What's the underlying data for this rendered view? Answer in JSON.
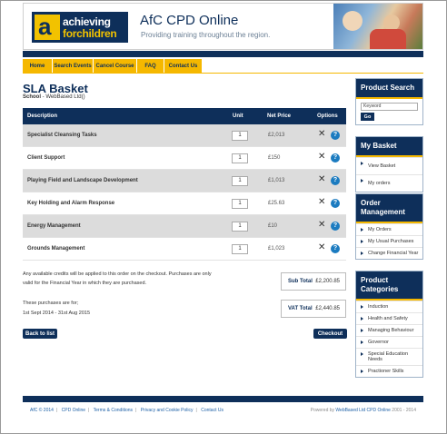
{
  "header": {
    "logo_line1": "achieving",
    "logo_line2": "forchildren",
    "site_title": "AfC CPD Online",
    "tagline": "Providing training throughout the region."
  },
  "nav": [
    "Home",
    "Search Events",
    "Cancel Course",
    "FAQ",
    "Contact Us"
  ],
  "page": {
    "title": "SLA Basket",
    "school_label": "School",
    "school_value": " - WebBased Ltd()"
  },
  "table": {
    "headers": {
      "description": "Description",
      "unit": "Unit",
      "net_price": "Net Price",
      "options": "Options"
    },
    "rows": [
      {
        "description": "Specialist Cleansing Tasks",
        "unit": "1",
        "price": "£2,013"
      },
      {
        "description": "Client Support",
        "unit": "1",
        "price": "£150"
      },
      {
        "description": "Playing Field and Landscape Development",
        "unit": "1",
        "price": "£1,013"
      },
      {
        "description": "Key Holding and Alarm Response",
        "unit": "1",
        "price": "£25.63"
      },
      {
        "description": "Energy Management",
        "unit": "1",
        "price": "£10"
      },
      {
        "description": "Grounds Management",
        "unit": "1",
        "price": "£1,023"
      }
    ],
    "delete_glyph": "✕",
    "info_glyph": "?"
  },
  "notes": {
    "credits_line1": "Any available credits will be applied to this order on the checkout. Purchases are only",
    "credits_line2": "valid for the Financial Year in which they are purchased.",
    "purchases_for": "These purchases are for;",
    "date_range": "1st Sept 2014 - 31st Aug 2015"
  },
  "totals": {
    "sub_total_label": "Sub Total",
    "sub_total_value": "£2,200.85",
    "vat_total_label": "VAT Total",
    "vat_total_value": "£2,440.85"
  },
  "buttons": {
    "back": "Back to list",
    "checkout": "Checkout"
  },
  "sidebar": {
    "product_search": {
      "title": "Product Search",
      "placeholder": "Keyword",
      "go": "Go"
    },
    "my_basket": {
      "title": "My Basket",
      "items": [
        "View Basket",
        "My orders"
      ]
    },
    "order_management": {
      "title": "Order Management",
      "items": [
        "My Orders",
        "My Usual Purchases",
        "Change Financial Year"
      ]
    },
    "product_categories": {
      "title": "Product Categories",
      "items": [
        "Induction",
        "Health and Safety",
        "Managing Behaviour",
        "Governor",
        "Special Education Needs",
        "Practioner Skills"
      ]
    }
  },
  "footer": {
    "links": [
      "AfC © 2014",
      "CPD Online",
      "Terms & Conditions",
      "Privacy and Cookie Policy",
      "Contact Us"
    ],
    "powered_prefix": "Powered by ",
    "powered_link": "WebBased Ltd CPD Online",
    "powered_suffix": " 2001 - 2014"
  },
  "colors": {
    "navy": "#0e2f5a",
    "yellow": "#f5b800",
    "info_blue": "#1b7bc0"
  }
}
